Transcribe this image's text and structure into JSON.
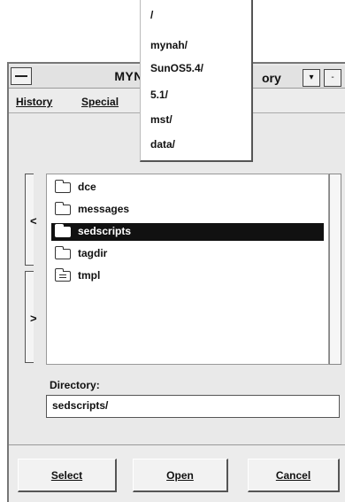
{
  "window": {
    "title": "MYNAH Se",
    "title_right": "ory"
  },
  "menu": {
    "history": "History",
    "special": "Special"
  },
  "nav": {
    "back_arrow": "<",
    "forward_arrow": ">"
  },
  "history_dropdown": {
    "items": [
      "/",
      "mynah/",
      "SunOS5.4/",
      "5.1/",
      "mst/",
      "data/"
    ]
  },
  "files": [
    {
      "name": "dce",
      "icon": "folder-icon",
      "selected": false
    },
    {
      "name": "messages",
      "icon": "folder-icon",
      "selected": false
    },
    {
      "name": "sedscripts",
      "icon": "folder-icon",
      "selected": true
    },
    {
      "name": "tagdir",
      "icon": "folder-icon",
      "selected": false
    },
    {
      "name": "tmpl",
      "icon": "document-icon",
      "selected": false
    }
  ],
  "directory": {
    "label": "Directory:",
    "value": "sedscripts/"
  },
  "buttons": {
    "select": "Select",
    "open": "Open",
    "cancel": "Cancel"
  },
  "window_buttons": {
    "menu": "▾",
    "minimize": "-"
  }
}
